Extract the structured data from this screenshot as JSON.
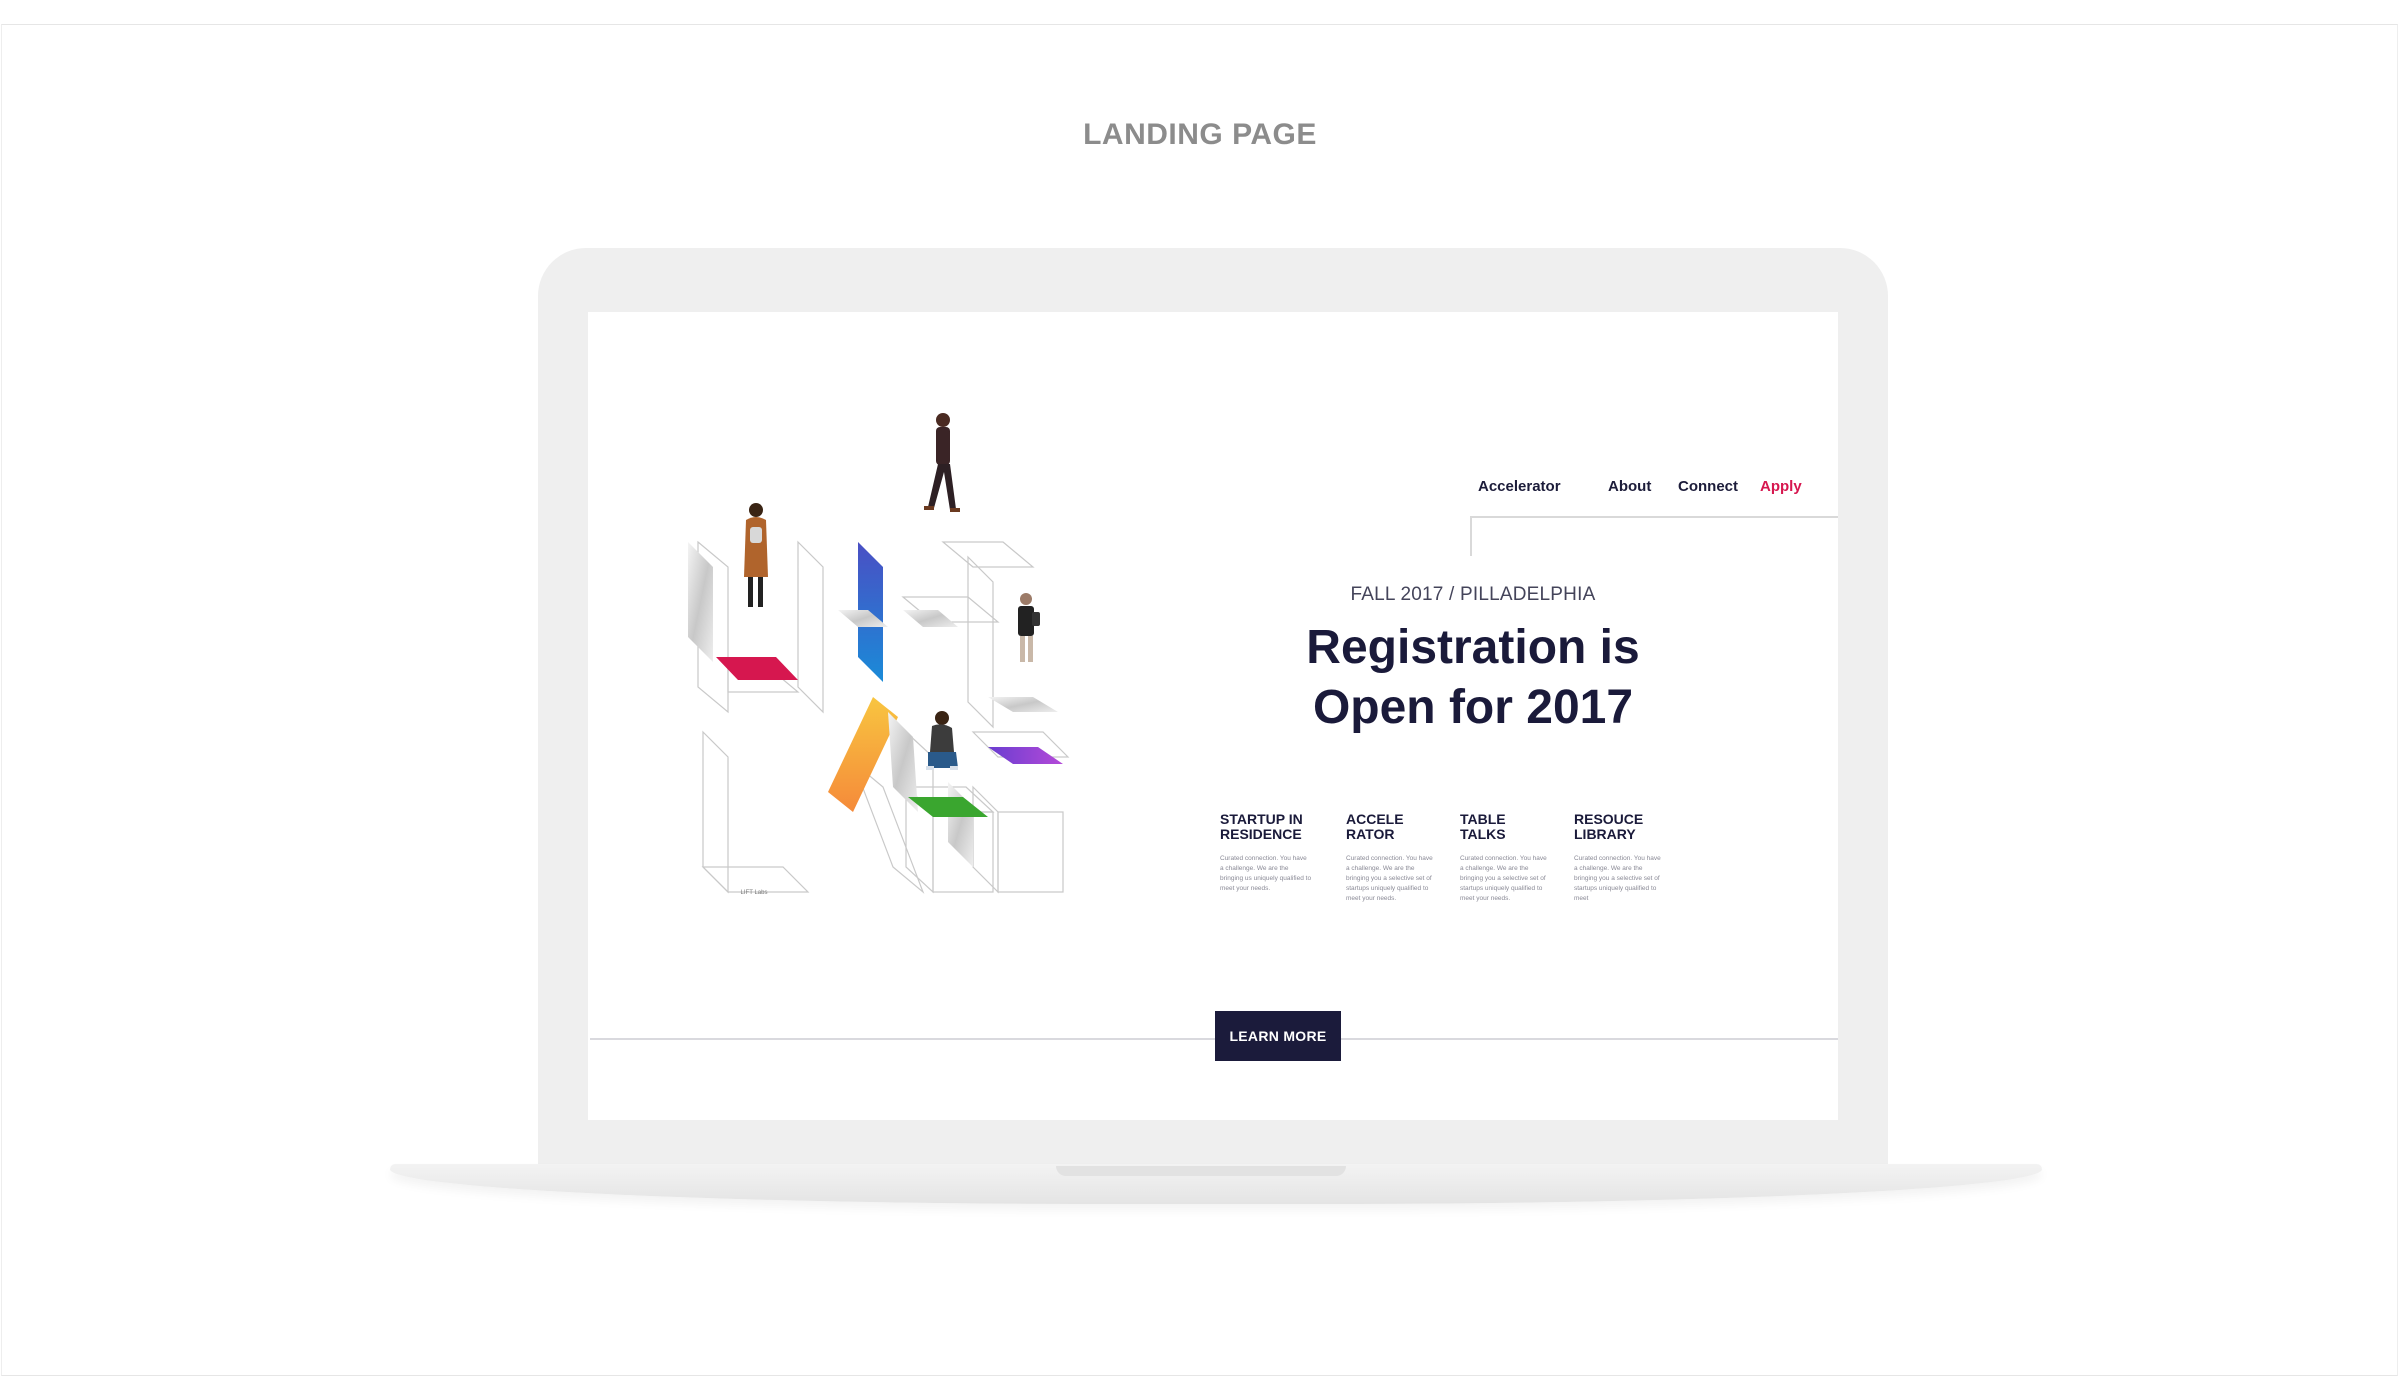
{
  "page": {
    "section_title": "LANDING PAGE"
  },
  "nav": {
    "items": [
      {
        "label": "Accelerator"
      },
      {
        "label": "About"
      },
      {
        "label": "Connect"
      },
      {
        "label": "Apply"
      }
    ],
    "active_color": "#d6174f"
  },
  "hero": {
    "eyebrow": "FALL 2017 / PILLADELPHIA",
    "headline": "Registration is Open for 2017",
    "logo_text": "LIFT Labs"
  },
  "features": [
    {
      "title": "STARTUP IN RESIDENCE",
      "body": "Curated connection. You have a challenge. We are the bringing us uniquely qualified to meet your needs."
    },
    {
      "title": "ACCELE RATOR",
      "body": "Curated connection. You have a challenge. We are the bringing you a selective set of startups uniquely qualified to meet your needs."
    },
    {
      "title": "TABLE TALKS",
      "body": "Curated connection. You have a challenge. We are the bringing you a selective set of startups uniquely qualified to meet your needs."
    },
    {
      "title": "RESOUCE LIBRARY",
      "body": "Curated connection. You have a challenge. We are the bringing you a selective set of startups uniquely qualified to meet"
    }
  ],
  "cta": {
    "label": "LEARN MORE"
  },
  "colors": {
    "navy": "#1b1b3b",
    "accent_red": "#d6174f",
    "accent_blue": "#1f6fd6",
    "accent_orange": "#f5a23a",
    "accent_green": "#3aa62f",
    "accent_purple": "#8a3fd6"
  }
}
